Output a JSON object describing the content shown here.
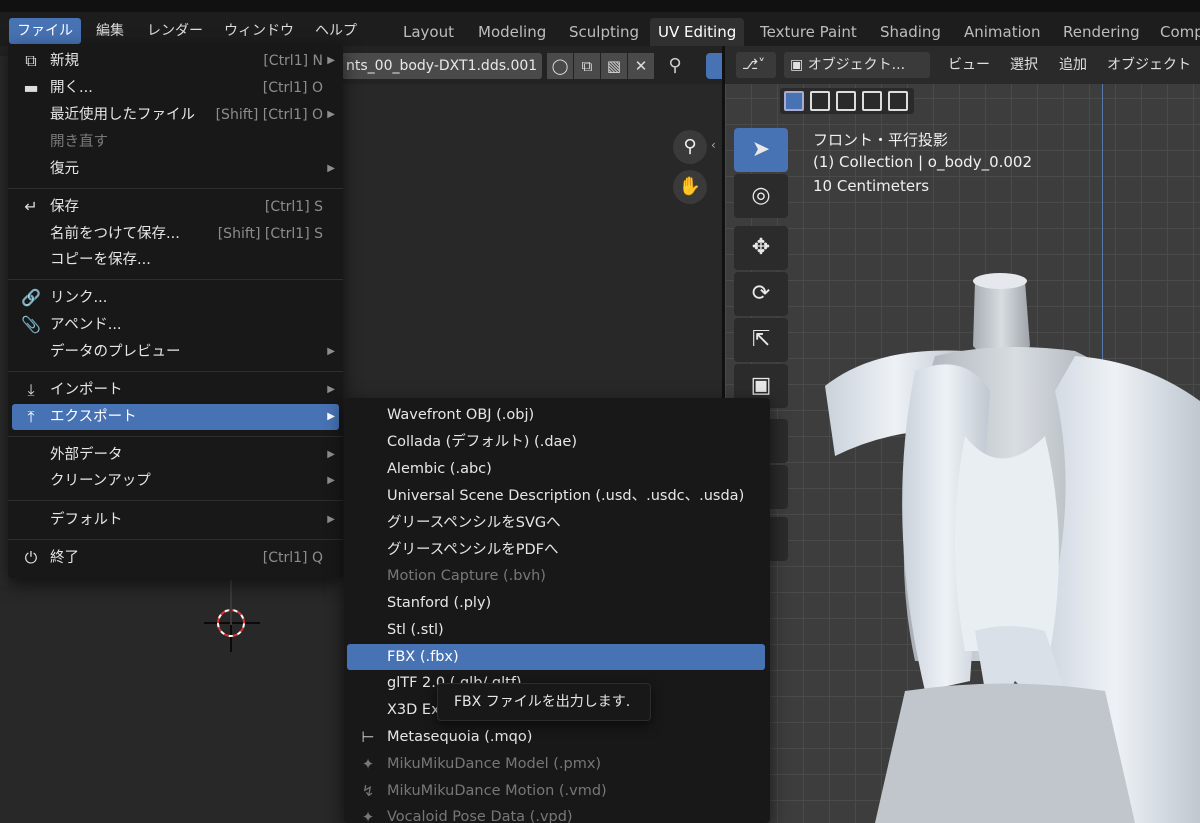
{
  "menubar": {
    "items": [
      {
        "label": "ファイル"
      },
      {
        "label": "編集"
      },
      {
        "label": "レンダー"
      },
      {
        "label": "ウィンドウ"
      },
      {
        "label": "ヘルプ"
      }
    ]
  },
  "workspaces": {
    "tabs": [
      {
        "label": "Layout"
      },
      {
        "label": "Modeling"
      },
      {
        "label": "Sculpting"
      },
      {
        "label": "UV Editing",
        "active": true
      },
      {
        "label": "Texture Paint"
      },
      {
        "label": "Shading"
      },
      {
        "label": "Animation"
      },
      {
        "label": "Rendering"
      },
      {
        "label": "Comp"
      }
    ]
  },
  "uv_editor": {
    "image_name": "nts_00_body-DXT1.dds.001"
  },
  "viewport": {
    "mode_label": "オブジェクト...",
    "menu": {
      "view": "ビュー",
      "select": "選択",
      "add": "追加",
      "object": "オブジェクト"
    },
    "overlay": {
      "view_name": "フロント・平行投影",
      "collection": "(1) Collection | o_body_0.002",
      "scale": "10 Centimeters"
    }
  },
  "file_menu": {
    "items": [
      {
        "icon": "new-file-icon",
        "label": "新規",
        "shortcut": "[Ctrl1] N"
      },
      {
        "icon": "folder-icon",
        "label": "開く...",
        "shortcut": "[Ctrl1] O"
      },
      {
        "icon": "",
        "label": "最近使用したファイル",
        "shortcut": "[Shift] [Ctrl1] O"
      },
      {
        "icon": "",
        "label": "開き直す",
        "shortcut": ""
      },
      {
        "icon": "",
        "label": "復元",
        "shortcut": ""
      },
      {
        "icon": "save-icon",
        "label": "保存",
        "shortcut": "[Ctrl1] S"
      },
      {
        "icon": "",
        "label": "名前をつけて保存...",
        "shortcut": "[Shift] [Ctrl1] S"
      },
      {
        "icon": "",
        "label": "コピーを保存...",
        "shortcut": ""
      },
      {
        "icon": "link-icon",
        "label": "リンク...",
        "shortcut": ""
      },
      {
        "icon": "paperclip-icon",
        "label": "アペンド...",
        "shortcut": ""
      },
      {
        "icon": "",
        "label": "データのプレビュー",
        "shortcut": ""
      },
      {
        "icon": "import-icon",
        "label": "インポート",
        "shortcut": ""
      },
      {
        "icon": "export-icon",
        "label": "エクスポート",
        "shortcut": ""
      },
      {
        "icon": "",
        "label": "外部データ",
        "shortcut": ""
      },
      {
        "icon": "",
        "label": "クリーンアップ",
        "shortcut": ""
      },
      {
        "icon": "",
        "label": "デフォルト",
        "shortcut": ""
      },
      {
        "icon": "power-icon",
        "label": "終了",
        "shortcut": "[Ctrl1] Q"
      }
    ]
  },
  "export_menu": {
    "items": [
      {
        "label": "Wavefront OBJ (.obj)"
      },
      {
        "label": "Collada (デフォルト) (.dae)"
      },
      {
        "label": "Alembic (.abc)"
      },
      {
        "label": "Universal Scene Description (.usd、.usdc、.usda)"
      },
      {
        "label": "グリースペンシルをSVGへ"
      },
      {
        "label": "グリースペンシルをPDFへ"
      },
      {
        "label": "Motion Capture (.bvh)"
      },
      {
        "label": "Stanford (.ply)"
      },
      {
        "label": "Stl (.stl)"
      },
      {
        "label": "FBX (.fbx)"
      },
      {
        "label": "glTF 2.0 (.glb/.gltf)"
      },
      {
        "label": "X3D Extensible 3D (.x3d)"
      },
      {
        "label": "Metasequoia (.mqo)"
      },
      {
        "label": "MikuMikuDance Model (.pmx)"
      },
      {
        "label": "MikuMikuDance Motion (.vmd)"
      },
      {
        "label": "Vocaloid Pose Data (.vpd)"
      }
    ]
  },
  "tooltip": {
    "text": "FBX ファイルを出力します."
  }
}
